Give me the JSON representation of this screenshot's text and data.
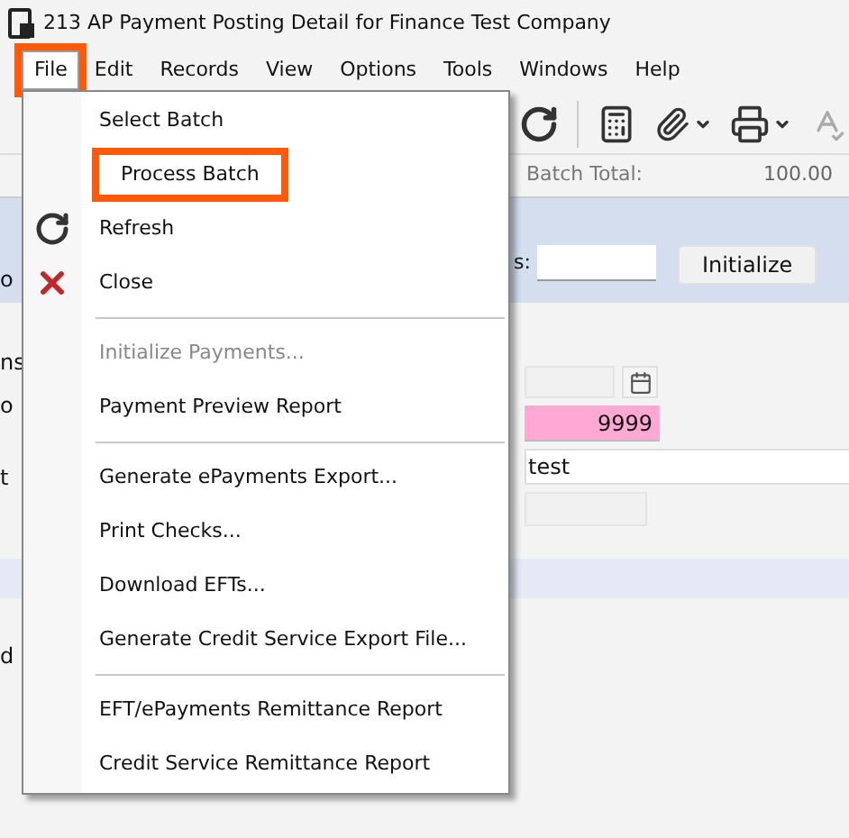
{
  "window": {
    "title": "213 AP Payment Posting Detail for Finance Test Company"
  },
  "menubar": [
    {
      "label": "File",
      "selected": true,
      "highlighted": true
    },
    {
      "label": "Edit",
      "selected": false,
      "highlighted": false
    },
    {
      "label": "Records",
      "selected": false,
      "highlighted": false
    },
    {
      "label": "View",
      "selected": false,
      "highlighted": false
    },
    {
      "label": "Options",
      "selected": false,
      "highlighted": false
    },
    {
      "label": "Tools",
      "selected": false,
      "highlighted": false
    },
    {
      "label": "Windows",
      "selected": false,
      "highlighted": false
    },
    {
      "label": "Help",
      "selected": false,
      "highlighted": false
    }
  ],
  "batch_total": {
    "label": "Batch Total:",
    "value": "100.00"
  },
  "initialize": {
    "label": "s:",
    "button": "Initialize"
  },
  "fields": [
    {
      "kind": "date"
    },
    {
      "kind": "required",
      "value": "9999"
    },
    {
      "kind": "text",
      "value": "test"
    },
    {
      "kind": "readonly"
    }
  ],
  "left_fragments": [
    "o",
    "ns",
    "o",
    "t",
    "d"
  ],
  "file_menu": [
    {
      "label": "Select Batch",
      "kind": "item",
      "disabled": false,
      "highlighted": false
    },
    {
      "label": "Process Batch",
      "kind": "item",
      "disabled": false,
      "highlighted": true
    },
    {
      "label": "Refresh",
      "kind": "item",
      "disabled": false,
      "highlighted": false
    },
    {
      "label": "Close",
      "kind": "item",
      "disabled": false,
      "highlighted": false
    },
    {
      "kind": "separator"
    },
    {
      "label": "Initialize Payments...",
      "kind": "item",
      "disabled": true,
      "highlighted": false
    },
    {
      "label": "Payment Preview Report",
      "kind": "item",
      "disabled": false,
      "highlighted": false
    },
    {
      "kind": "separator"
    },
    {
      "label": "Generate ePayments Export...",
      "kind": "item",
      "disabled": false,
      "highlighted": false
    },
    {
      "label": "Print Checks...",
      "kind": "item",
      "disabled": false,
      "highlighted": false
    },
    {
      "label": "Download EFTs...",
      "kind": "item",
      "disabled": false,
      "highlighted": false
    },
    {
      "label": "Generate Credit Service Export File...",
      "kind": "item",
      "disabled": false,
      "highlighted": false
    },
    {
      "kind": "separator"
    },
    {
      "label": "EFT/ePayments Remittance Report",
      "kind": "item",
      "disabled": false,
      "highlighted": false
    },
    {
      "label": "Credit Service Remittance Report",
      "kind": "item",
      "disabled": false,
      "highlighted": false
    }
  ]
}
